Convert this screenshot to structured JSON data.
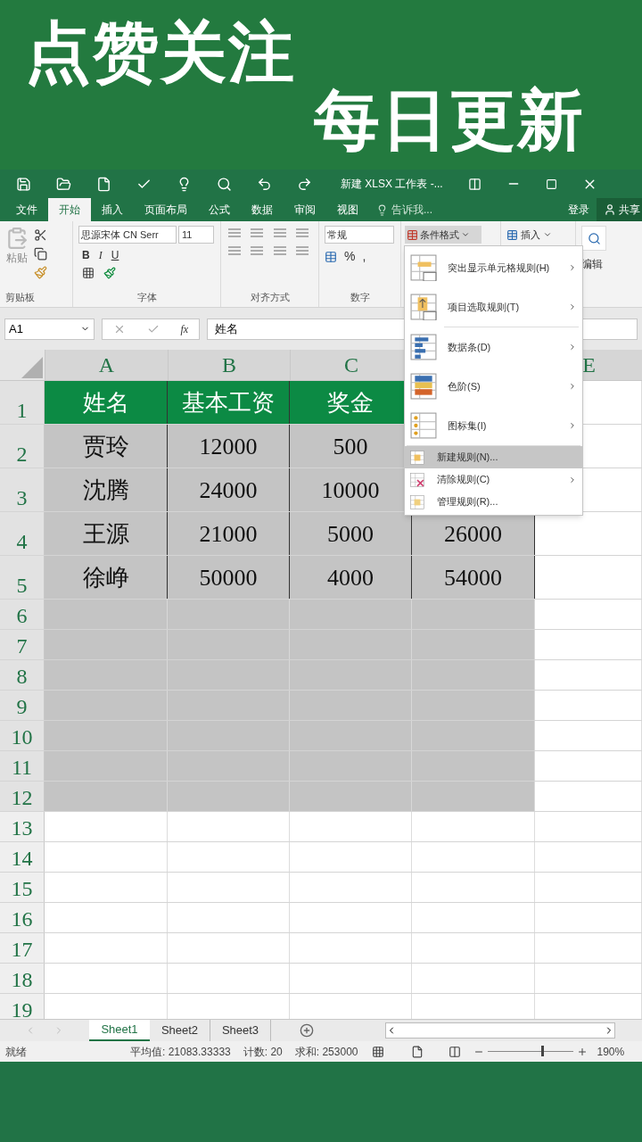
{
  "banner": {
    "line1": "点赞关注",
    "line2": "每日更新"
  },
  "window": {
    "title": "新建 XLSX 工作表 -..."
  },
  "ribbon_tabs": [
    {
      "label": "文件",
      "selected": false
    },
    {
      "label": "开始",
      "selected": true
    },
    {
      "label": "插入",
      "selected": false
    },
    {
      "label": "页面布局",
      "selected": false
    },
    {
      "label": "公式",
      "selected": false
    },
    {
      "label": "数据",
      "selected": false
    },
    {
      "label": "审阅",
      "selected": false
    },
    {
      "label": "视图",
      "selected": false
    }
  ],
  "tell_me": "告诉我...",
  "sign_in": "登录",
  "share": "共享",
  "ribbon": {
    "paste": "粘贴",
    "clipboard_group": "剪贴板",
    "font_name": "思源宋体 CN Serr",
    "font_size": "11",
    "bold": "B",
    "italic": "I",
    "underline": "U",
    "font_group": "字体",
    "alignment_group": "对齐方式",
    "number_format": "常规",
    "percent": "%",
    "comma": ",",
    "number_group": "数字",
    "conditional_formatting": "条件格式",
    "insert": "插入",
    "editing_group": "编辑"
  },
  "formula_bar": {
    "name_box": "A1",
    "function_button": "fx",
    "value": "姓名"
  },
  "column_headers": [
    "A",
    "B",
    "C",
    "E"
  ],
  "rows": [
    {
      "number": "1",
      "kind": "header",
      "selected": true,
      "cells": [
        "姓名",
        "基本工资",
        "奖金"
      ]
    },
    {
      "number": "2",
      "kind": "data",
      "selected": true,
      "cells": [
        "贾玲",
        "12000",
        "500"
      ]
    },
    {
      "number": "3",
      "kind": "data",
      "selected": true,
      "cells": [
        "沈腾",
        "24000",
        "10000"
      ]
    },
    {
      "number": "4",
      "kind": "data",
      "selected": true,
      "cells": [
        "王源",
        "21000",
        "5000",
        "26000"
      ]
    },
    {
      "number": "5",
      "kind": "data",
      "selected": true,
      "cells": [
        "徐峥",
        "50000",
        "4000",
        "54000"
      ]
    },
    {
      "number": "6",
      "kind": "empty",
      "selected": true,
      "cells": []
    },
    {
      "number": "7",
      "kind": "empty",
      "selected": true,
      "cells": []
    },
    {
      "number": "8",
      "kind": "empty",
      "selected": true,
      "cells": []
    },
    {
      "number": "9",
      "kind": "empty",
      "selected": true,
      "cells": []
    },
    {
      "number": "10",
      "kind": "empty",
      "selected": true,
      "cells": []
    },
    {
      "number": "11",
      "kind": "empty",
      "selected": true,
      "cells": []
    },
    {
      "number": "12",
      "kind": "empty",
      "selected": true,
      "cells": []
    },
    {
      "number": "13",
      "kind": "empty",
      "selected": false,
      "cells": []
    },
    {
      "number": "14",
      "kind": "empty",
      "selected": false,
      "cells": []
    },
    {
      "number": "15",
      "kind": "empty",
      "selected": false,
      "cells": []
    },
    {
      "number": "16",
      "kind": "empty",
      "selected": false,
      "cells": []
    },
    {
      "number": "17",
      "kind": "empty",
      "selected": false,
      "cells": []
    },
    {
      "number": "18",
      "kind": "empty",
      "selected": false,
      "cells": []
    },
    {
      "number": "19",
      "kind": "empty",
      "selected": false,
      "cells": []
    }
  ],
  "menu": [
    {
      "label": "突出显示单元格规则(H)",
      "kind": "large",
      "submenu": true,
      "selected": false
    },
    {
      "label": "项目选取规则(T)",
      "kind": "large",
      "submenu": true,
      "selected": false
    },
    {
      "label": "数据条(D)",
      "kind": "large",
      "submenu": true,
      "selected": false
    },
    {
      "label": "色阶(S)",
      "kind": "large",
      "submenu": true,
      "selected": false
    },
    {
      "label": "图标集(I)",
      "kind": "large",
      "submenu": true,
      "selected": false
    },
    {
      "label": "新建规则(N)...",
      "kind": "small",
      "submenu": false,
      "selected": true
    },
    {
      "label": "清除规则(C)",
      "kind": "small",
      "submenu": true,
      "selected": false
    },
    {
      "label": "管理规则(R)...",
      "kind": "small",
      "submenu": false,
      "selected": false
    }
  ],
  "sheet_tabs": [
    {
      "label": "Sheet1",
      "selected": true
    },
    {
      "label": "Sheet2",
      "selected": false
    },
    {
      "label": "Sheet3",
      "selected": false
    }
  ],
  "status_bar": {
    "ready": "就绪",
    "average": "平均值: 21083.33333",
    "count": "计数: 20",
    "sum": "求和: 253000",
    "zoom": "190%",
    "zoom_slider": {
      "level": 0.62
    }
  }
}
